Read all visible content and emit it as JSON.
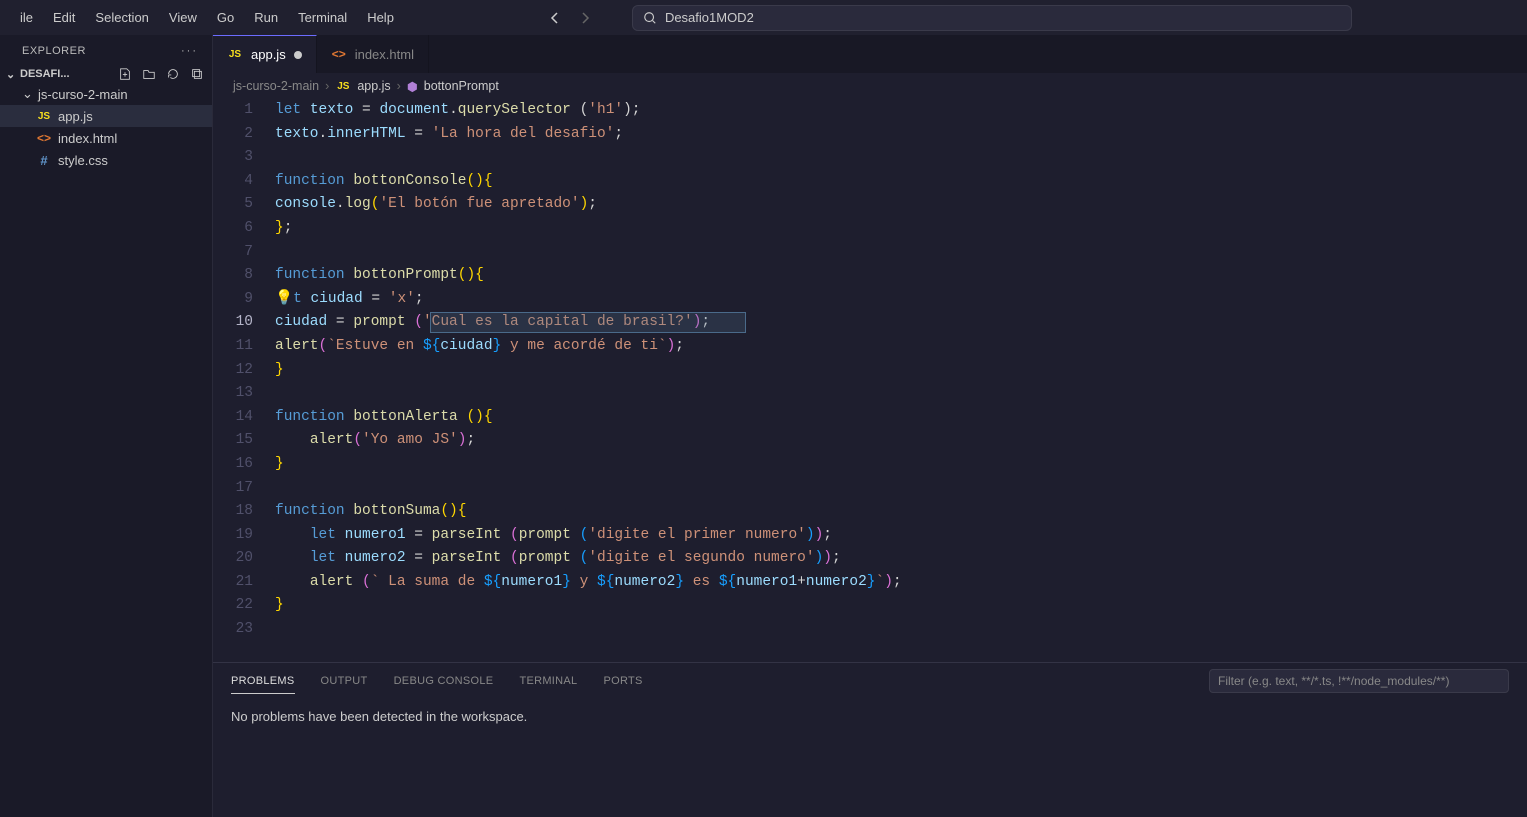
{
  "menubar": {
    "items": [
      "ile",
      "Edit",
      "Selection",
      "View",
      "Go",
      "Run",
      "Terminal",
      "Help"
    ]
  },
  "search": {
    "text": "Desafio1MOD2"
  },
  "explorer": {
    "title": "EXPLORER",
    "root": "DESAFI...",
    "folder": "js-curso-2-main",
    "files": [
      {
        "name": "app.js",
        "type": "js",
        "selected": true
      },
      {
        "name": "index.html",
        "type": "html",
        "selected": false
      },
      {
        "name": "style.css",
        "type": "css",
        "selected": false
      }
    ]
  },
  "tabs": [
    {
      "label": "app.js",
      "type": "js",
      "active": true,
      "dirty": true
    },
    {
      "label": "index.html",
      "type": "html",
      "active": false,
      "dirty": false
    }
  ],
  "breadcrumbs": {
    "parts": [
      "js-curso-2-main",
      "app.js",
      "bottonPrompt"
    ]
  },
  "code": {
    "current_line": 10,
    "lines": [
      {
        "n": 1,
        "t": [
          [
            "k-blue",
            "let "
          ],
          [
            "k-var",
            "texto"
          ],
          [
            "k-white",
            " = "
          ],
          [
            "k-var",
            "document"
          ],
          [
            "k-white",
            "."
          ],
          [
            "k-fn",
            "querySelector"
          ],
          [
            "k-white",
            " ("
          ],
          [
            "k-str",
            "'h1'"
          ],
          [
            "k-white",
            ");"
          ]
        ]
      },
      {
        "n": 2,
        "t": [
          [
            "k-var",
            "texto"
          ],
          [
            "k-white",
            "."
          ],
          [
            "k-var",
            "innerHTML"
          ],
          [
            "k-white",
            " = "
          ],
          [
            "k-str",
            "'La hora del desafio'"
          ],
          [
            "k-white",
            ";"
          ]
        ]
      },
      {
        "n": 3,
        "t": []
      },
      {
        "n": 4,
        "t": [
          [
            "k-blue",
            "function "
          ],
          [
            "k-fn",
            "bottonConsole"
          ],
          [
            "k-brace",
            "()"
          ],
          [
            "k-brace",
            "{"
          ]
        ]
      },
      {
        "n": 5,
        "t": [
          [
            "k-var",
            "console"
          ],
          [
            "k-white",
            "."
          ],
          [
            "k-fn",
            "log"
          ],
          [
            "k-brace",
            "("
          ],
          [
            "k-str",
            "'El botón fue apretado'"
          ],
          [
            "k-brace",
            ")"
          ],
          [
            "k-white",
            ";"
          ]
        ]
      },
      {
        "n": 6,
        "t": [
          [
            "k-brace",
            "}"
          ],
          [
            "k-white",
            ";"
          ]
        ]
      },
      {
        "n": 7,
        "t": []
      },
      {
        "n": 8,
        "t": [
          [
            "k-blue",
            "function "
          ],
          [
            "k-fn",
            "bottonPrompt"
          ],
          [
            "k-brace",
            "()"
          ],
          [
            "k-brace",
            "{"
          ]
        ]
      },
      {
        "n": 9,
        "t": [
          [
            "bulb",
            "💡"
          ],
          [
            "k-blue",
            "t "
          ],
          [
            "k-var",
            "ciudad"
          ],
          [
            "k-white",
            " = "
          ],
          [
            "k-str",
            "'x'"
          ],
          [
            "k-white",
            ";"
          ]
        ]
      },
      {
        "n": 10,
        "t": [
          [
            "k-var",
            "ciudad"
          ],
          [
            "k-white",
            " = "
          ],
          [
            "k-fn",
            "prompt"
          ],
          [
            "k-white",
            " "
          ],
          [
            "k-brace2",
            "("
          ],
          [
            "k-str",
            "'Cual es la capital de brasil?'"
          ],
          [
            "k-brace2",
            ")"
          ],
          [
            "k-white",
            ";"
          ]
        ]
      },
      {
        "n": 11,
        "t": [
          [
            "k-fn",
            "alert"
          ],
          [
            "k-brace2",
            "("
          ],
          [
            "k-str",
            "`Estuve en "
          ],
          [
            "k-brace3",
            "${"
          ],
          [
            "k-var",
            "ciudad"
          ],
          [
            "k-brace3",
            "}"
          ],
          [
            "k-str",
            " y me acordé de ti`"
          ],
          [
            "k-brace2",
            ")"
          ],
          [
            "k-white",
            ";"
          ]
        ]
      },
      {
        "n": 12,
        "t": [
          [
            "k-brace",
            "}"
          ]
        ]
      },
      {
        "n": 13,
        "t": []
      },
      {
        "n": 14,
        "t": [
          [
            "k-blue",
            "function "
          ],
          [
            "k-fn",
            "bottonAlerta"
          ],
          [
            "k-white",
            " "
          ],
          [
            "k-brace",
            "()"
          ],
          [
            "k-brace",
            "{"
          ]
        ]
      },
      {
        "n": 15,
        "t": [
          [
            "k-white",
            "    "
          ],
          [
            "k-fn",
            "alert"
          ],
          [
            "k-brace2",
            "("
          ],
          [
            "k-str",
            "'Yo amo JS'"
          ],
          [
            "k-brace2",
            ")"
          ],
          [
            "k-white",
            ";"
          ]
        ]
      },
      {
        "n": 16,
        "t": [
          [
            "k-brace",
            "}"
          ]
        ]
      },
      {
        "n": 17,
        "t": []
      },
      {
        "n": 18,
        "t": [
          [
            "k-blue",
            "function "
          ],
          [
            "k-fn",
            "bottonSuma"
          ],
          [
            "k-brace",
            "()"
          ],
          [
            "k-brace",
            "{"
          ]
        ]
      },
      {
        "n": 19,
        "t": [
          [
            "k-white",
            "    "
          ],
          [
            "k-blue",
            "let "
          ],
          [
            "k-var",
            "numero1"
          ],
          [
            "k-white",
            " = "
          ],
          [
            "k-fn",
            "parseInt"
          ],
          [
            "k-white",
            " "
          ],
          [
            "k-brace2",
            "("
          ],
          [
            "k-fn",
            "prompt"
          ],
          [
            "k-white",
            " "
          ],
          [
            "k-brace3",
            "("
          ],
          [
            "k-str",
            "'digite el primer numero'"
          ],
          [
            "k-brace3",
            ")"
          ],
          [
            "k-brace2",
            ")"
          ],
          [
            "k-white",
            ";"
          ]
        ]
      },
      {
        "n": 20,
        "t": [
          [
            "k-white",
            "    "
          ],
          [
            "k-blue",
            "let "
          ],
          [
            "k-var",
            "numero2"
          ],
          [
            "k-white",
            " = "
          ],
          [
            "k-fn",
            "parseInt"
          ],
          [
            "k-white",
            " "
          ],
          [
            "k-brace2",
            "("
          ],
          [
            "k-fn",
            "prompt"
          ],
          [
            "k-white",
            " "
          ],
          [
            "k-brace3",
            "("
          ],
          [
            "k-str",
            "'digite el segundo numero'"
          ],
          [
            "k-brace3",
            ")"
          ],
          [
            "k-brace2",
            ")"
          ],
          [
            "k-white",
            ";"
          ]
        ]
      },
      {
        "n": 21,
        "t": [
          [
            "k-white",
            "    "
          ],
          [
            "k-fn",
            "alert"
          ],
          [
            "k-white",
            " "
          ],
          [
            "k-brace2",
            "("
          ],
          [
            "k-str",
            "` La suma de "
          ],
          [
            "k-brace3",
            "${"
          ],
          [
            "k-var",
            "numero1"
          ],
          [
            "k-brace3",
            "}"
          ],
          [
            "k-str",
            " y "
          ],
          [
            "k-brace3",
            "${"
          ],
          [
            "k-var",
            "numero2"
          ],
          [
            "k-brace3",
            "}"
          ],
          [
            "k-str",
            " es "
          ],
          [
            "k-brace3",
            "${"
          ],
          [
            "k-var",
            "numero1"
          ],
          [
            "k-white",
            "+"
          ],
          [
            "k-var",
            "numero2"
          ],
          [
            "k-brace3",
            "}"
          ],
          [
            "k-str",
            "`"
          ],
          [
            "k-brace2",
            ")"
          ],
          [
            "k-white",
            ";"
          ]
        ]
      },
      {
        "n": 22,
        "t": [
          [
            "k-brace",
            "}"
          ]
        ]
      },
      {
        "n": 23,
        "t": []
      }
    ]
  },
  "panel": {
    "tabs": [
      "PROBLEMS",
      "OUTPUT",
      "DEBUG CONSOLE",
      "TERMINAL",
      "PORTS"
    ],
    "active_tab": "PROBLEMS",
    "filter_placeholder": "Filter (e.g. text, **/*.ts, !**/node_modules/**)",
    "body": "No problems have been detected in the workspace."
  }
}
